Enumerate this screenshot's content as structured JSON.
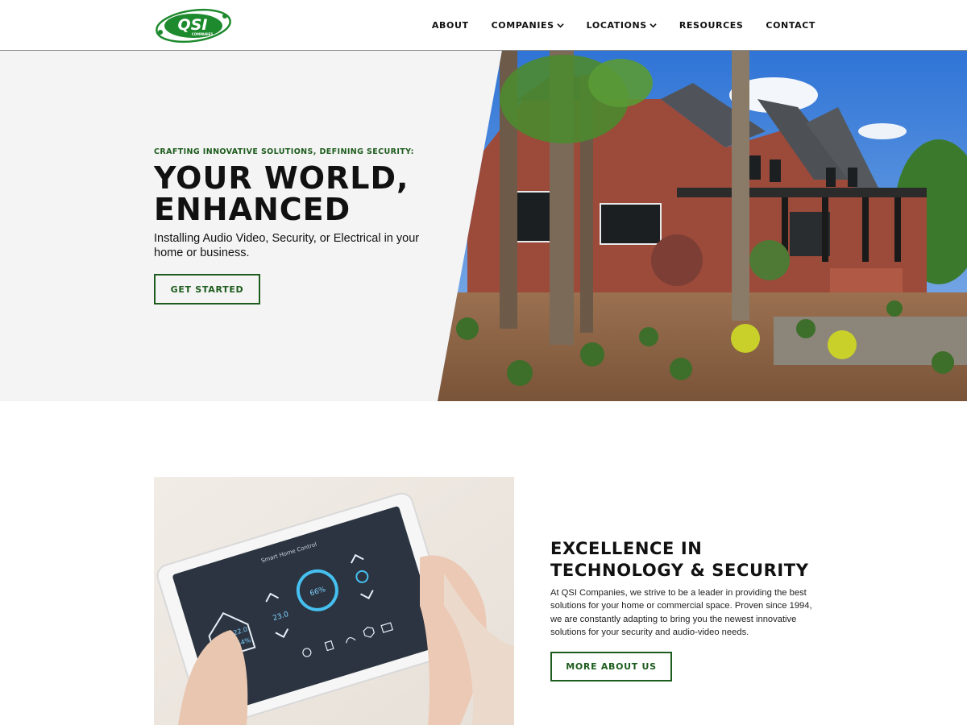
{
  "brand": {
    "logo_text": "QSI",
    "logo_subtext": "COMPANIES"
  },
  "nav": {
    "items": [
      {
        "label": "ABOUT",
        "dropdown": false
      },
      {
        "label": "COMPANIES",
        "dropdown": true
      },
      {
        "label": "LOCATIONS",
        "dropdown": true
      },
      {
        "label": "RESOURCES",
        "dropdown": false
      },
      {
        "label": "CONTACT",
        "dropdown": false
      }
    ]
  },
  "hero": {
    "eyebrow": "CRAFTING INNOVATIVE SOLUTIONS, DEFINING SECURITY:",
    "title_line1": "YOUR WORLD,",
    "title_line2": "ENHANCED",
    "subtitle": "Installing Audio Video, Security, or Electrical in your home or business.",
    "cta_label": "GET STARTED"
  },
  "tablet": {
    "screen_title": "Smart Home Control",
    "temp_small": "22.0",
    "humidity": "54%",
    "temp_main": "23.0",
    "dial_value": "66%",
    "icons": [
      "Lighting",
      "Music",
      "Network",
      "Security",
      "Camera"
    ]
  },
  "about": {
    "title_line1": "EXCELLENCE IN",
    "title_line2": "TECHNOLOGY & SECURITY",
    "body": "At QSI Companies, we strive to be a leader in providing the best solutions for your home or commercial space. Proven since 1994, we are constantly adapting to bring you the newest innovative solutions for your security and audio-video needs.",
    "cta_label": "MORE ABOUT US"
  },
  "colors": {
    "brand_green": "#1d5c1d",
    "logo_green": "#1e8a2e",
    "hero_bg": "#f4f4f4"
  }
}
